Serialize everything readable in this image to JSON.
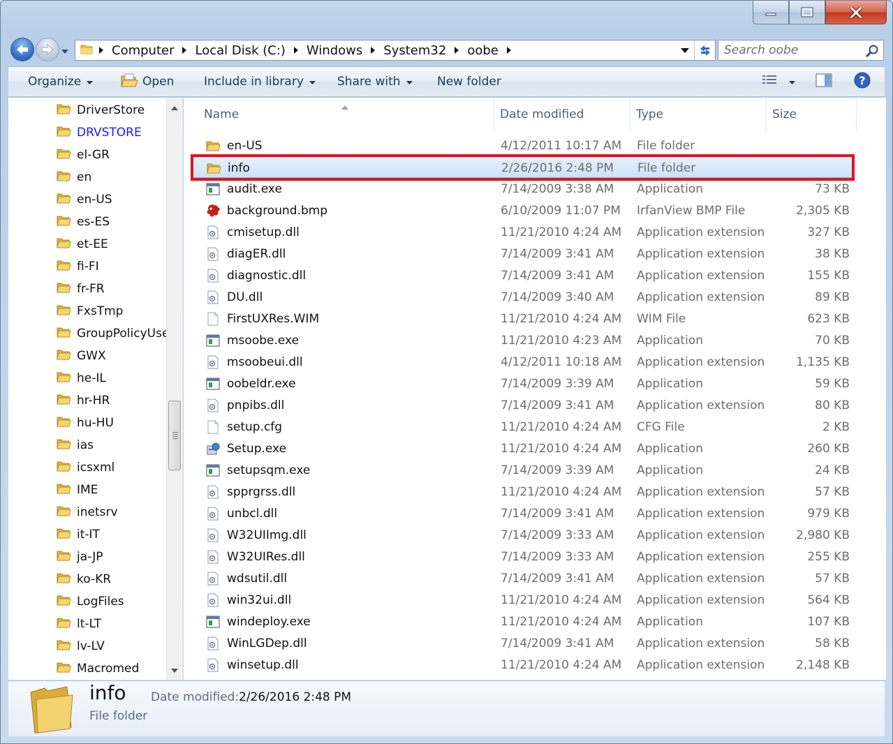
{
  "breadcrumb": [
    "Computer",
    "Local Disk (C:)",
    "Windows",
    "System32",
    "oobe"
  ],
  "search": {
    "placeholder": "Search oobe"
  },
  "toolbar": {
    "organize": "Organize",
    "open": "Open",
    "include": "Include in library",
    "share": "Share with",
    "new_folder": "New folder"
  },
  "nav_items": [
    "DriverStore",
    "DRVSTORE",
    "el-GR",
    "en",
    "en-US",
    "es-ES",
    "et-EE",
    "fi-FI",
    "fr-FR",
    "FxsTmp",
    "GroupPolicyUse",
    "GWX",
    "he-IL",
    "hr-HR",
    "hu-HU",
    "ias",
    "icsxml",
    "IME",
    "inetsrv",
    "it-IT",
    "ja-JP",
    "ko-KR",
    "LogFiles",
    "lt-LT",
    "lv-LV",
    "Macromed"
  ],
  "columns": {
    "name": "Name",
    "date": "Date modified",
    "type": "Type",
    "size": "Size"
  },
  "files": [
    {
      "name": "en-US",
      "date": "4/12/2011 10:17 AM",
      "type": "File folder",
      "size": "",
      "icon": "folder-icon"
    },
    {
      "name": "info",
      "date": "2/26/2016 2:48 PM",
      "type": "File folder",
      "size": "",
      "icon": "folder-icon",
      "selected": true
    },
    {
      "name": "audit.exe",
      "date": "7/14/2009 3:38 AM",
      "type": "Application",
      "size": "73 KB",
      "icon": "exe-icon"
    },
    {
      "name": "background.bmp",
      "date": "6/10/2009 11:07 PM",
      "type": "IrfanView BMP File",
      "size": "2,305 KB",
      "icon": "irfanview-icon"
    },
    {
      "name": "cmisetup.dll",
      "date": "11/21/2010 4:24 AM",
      "type": "Application extension",
      "size": "327 KB",
      "icon": "dll-icon"
    },
    {
      "name": "diagER.dll",
      "date": "7/14/2009 3:41 AM",
      "type": "Application extension",
      "size": "38 KB",
      "icon": "dll-icon"
    },
    {
      "name": "diagnostic.dll",
      "date": "7/14/2009 3:41 AM",
      "type": "Application extension",
      "size": "155 KB",
      "icon": "dll-icon"
    },
    {
      "name": "DU.dll",
      "date": "7/14/2009 3:40 AM",
      "type": "Application extension",
      "size": "89 KB",
      "icon": "dll-icon"
    },
    {
      "name": "FirstUXRes.WIM",
      "date": "11/21/2010 4:24 AM",
      "type": "WIM File",
      "size": "623 KB",
      "icon": "file-icon"
    },
    {
      "name": "msoobe.exe",
      "date": "11/21/2010 4:23 AM",
      "type": "Application",
      "size": "70 KB",
      "icon": "exe-icon"
    },
    {
      "name": "msoobeui.dll",
      "date": "4/12/2011 10:18 AM",
      "type": "Application extension",
      "size": "1,135 KB",
      "icon": "dll-icon"
    },
    {
      "name": "oobeldr.exe",
      "date": "7/14/2009 3:39 AM",
      "type": "Application",
      "size": "59 KB",
      "icon": "exe-icon"
    },
    {
      "name": "pnpibs.dll",
      "date": "7/14/2009 3:41 AM",
      "type": "Application extension",
      "size": "80 KB",
      "icon": "dll-icon"
    },
    {
      "name": "setup.cfg",
      "date": "11/21/2010 4:24 AM",
      "type": "CFG File",
      "size": "2 KB",
      "icon": "file-icon"
    },
    {
      "name": "Setup.exe",
      "date": "11/21/2010 4:24 AM",
      "type": "Application",
      "size": "260 KB",
      "icon": "setup-icon"
    },
    {
      "name": "setupsqm.exe",
      "date": "7/14/2009 3:39 AM",
      "type": "Application",
      "size": "24 KB",
      "icon": "exe-icon"
    },
    {
      "name": "spprgrss.dll",
      "date": "11/21/2010 4:24 AM",
      "type": "Application extension",
      "size": "57 KB",
      "icon": "dll-icon"
    },
    {
      "name": "unbcl.dll",
      "date": "7/14/2009 3:41 AM",
      "type": "Application extension",
      "size": "979 KB",
      "icon": "dll-icon"
    },
    {
      "name": "W32UIImg.dll",
      "date": "7/14/2009 3:33 AM",
      "type": "Application extension",
      "size": "2,980 KB",
      "icon": "dll-icon"
    },
    {
      "name": "W32UIRes.dll",
      "date": "7/14/2009 3:33 AM",
      "type": "Application extension",
      "size": "255 KB",
      "icon": "dll-icon"
    },
    {
      "name": "wdsutil.dll",
      "date": "7/14/2009 3:41 AM",
      "type": "Application extension",
      "size": "57 KB",
      "icon": "dll-icon"
    },
    {
      "name": "win32ui.dll",
      "date": "11/21/2010 4:24 AM",
      "type": "Application extension",
      "size": "564 KB",
      "icon": "dll-icon"
    },
    {
      "name": "windeploy.exe",
      "date": "11/21/2010 4:24 AM",
      "type": "Application",
      "size": "107 KB",
      "icon": "exe-icon"
    },
    {
      "name": "WinLGDep.dll",
      "date": "7/14/2009 3:41 AM",
      "type": "Application extension",
      "size": "58 KB",
      "icon": "dll-icon"
    },
    {
      "name": "winsetup.dll",
      "date": "11/21/2010 4:24 AM",
      "type": "Application extension",
      "size": "2,148 KB",
      "icon": "dll-icon"
    }
  ],
  "details": {
    "name": "info",
    "type": "File folder",
    "date_label": "Date modified:",
    "date_value": "2/26/2016 2:48 PM"
  },
  "colors": {
    "highlight": "#e0141e",
    "selection": "#cde3f8",
    "accent": "#1e395b"
  }
}
